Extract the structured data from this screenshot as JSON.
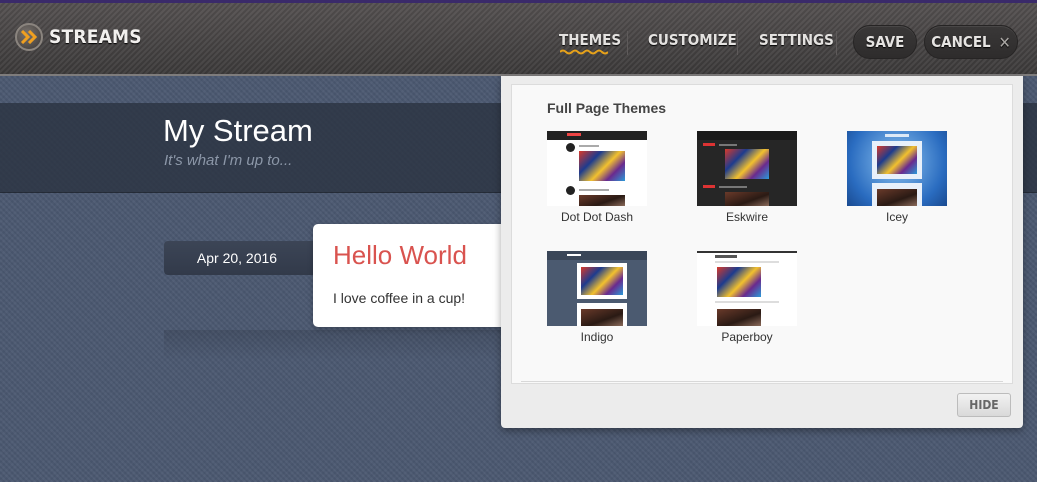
{
  "app": {
    "logo_text": "STREAMS"
  },
  "nav": {
    "themes": "THEMES",
    "customize": "CUSTOMIZE",
    "settings": "SETTINGS",
    "save": "SAVE",
    "cancel": "CANCEL"
  },
  "stream": {
    "title": "My Stream",
    "subtitle": "It's what I'm up to..."
  },
  "post": {
    "date": "Apr 20, 2016",
    "title": "Hello World",
    "body": "I love coffee in a cup!"
  },
  "themes_panel": {
    "heading": "Full Page Themes",
    "themes": [
      {
        "name": "Dot Dot Dash"
      },
      {
        "name": "Eskwire"
      },
      {
        "name": "Icey"
      },
      {
        "name": "Indigo"
      },
      {
        "name": "Paperboy"
      }
    ],
    "hide_label": "HIDE"
  },
  "colors": {
    "accent_underline": "#e7a21a",
    "post_title": "#d9534f",
    "background": "#4a5870"
  }
}
